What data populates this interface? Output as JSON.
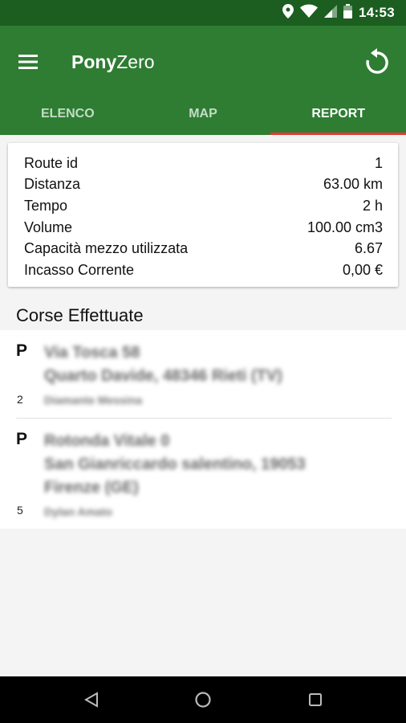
{
  "status_bar": {
    "time": "14:53",
    "icons": [
      "location-icon",
      "wifi-icon",
      "signal-icon",
      "battery-icon"
    ]
  },
  "app_bar": {
    "title_bold": "Pony",
    "title_regular": "Zero",
    "left_icon": "menu-icon",
    "right_icon": "refresh-icon",
    "color": "#2e7d32",
    "status_color": "#1b5e20"
  },
  "tabs": [
    {
      "label": "ELENCO",
      "active": false
    },
    {
      "label": "MAP",
      "active": false
    },
    {
      "label": "REPORT",
      "active": true
    }
  ],
  "tab_indicator_color": "#e53935",
  "report": [
    {
      "label": "Route id",
      "value": "1"
    },
    {
      "label": "Distanza",
      "value": "63.00 km"
    },
    {
      "label": "Tempo",
      "value": "2 h"
    },
    {
      "label": "Volume",
      "value": "100.00 cm3"
    },
    {
      "label": "Capacità mezzo utilizzata",
      "value": "6.67"
    },
    {
      "label": "Incasso Corrente",
      "value": "0,00 €"
    }
  ],
  "section_title": "Corse Effettuate",
  "rides": [
    {
      "type": "P",
      "address_lines": [
        "Via Tosca 58",
        "Quarto Davide, 48346 Rieti (TV)"
      ],
      "number": "2",
      "name": "Diamante Messina"
    },
    {
      "type": "P",
      "address_lines": [
        "Rotonda Vitale 0",
        "San Gianriccardo salentino, 19053",
        "Firenze (GE)"
      ],
      "number": "5",
      "name": "Dylan Amato"
    }
  ],
  "nav_bar": {
    "icons": [
      "back-icon",
      "home-icon",
      "recents-icon"
    ]
  }
}
